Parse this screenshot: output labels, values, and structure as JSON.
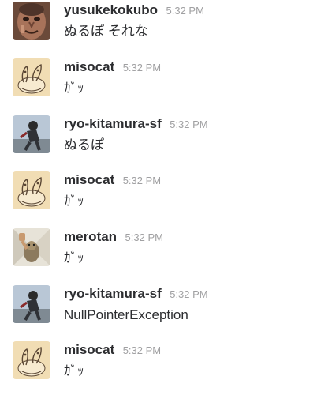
{
  "messages": [
    {
      "user": "yusukekokubo",
      "time": "5:32 PM",
      "text": "ぬるぽ それな",
      "avatar": "statue-face-avatar"
    },
    {
      "user": "misocat",
      "time": "5:32 PM",
      "text": "ｶﾞｯ",
      "avatar": "cat-sketch-avatar"
    },
    {
      "user": "ryo-kitamura-sf",
      "time": "5:32 PM",
      "text": "ぬるぽ",
      "avatar": "person-photo-avatar"
    },
    {
      "user": "misocat",
      "time": "5:32 PM",
      "text": "ｶﾞｯ",
      "avatar": "cat-sketch-avatar"
    },
    {
      "user": "merotan",
      "time": "5:32 PM",
      "text": "ｶﾞｯ",
      "avatar": "dog-fist-avatar"
    },
    {
      "user": "ryo-kitamura-sf",
      "time": "5:32 PM",
      "text": "NullPointerException",
      "avatar": "person-photo-avatar"
    },
    {
      "user": "misocat",
      "time": "5:32 PM",
      "text": "ｶﾞｯ",
      "avatar": "cat-sketch-avatar"
    }
  ]
}
